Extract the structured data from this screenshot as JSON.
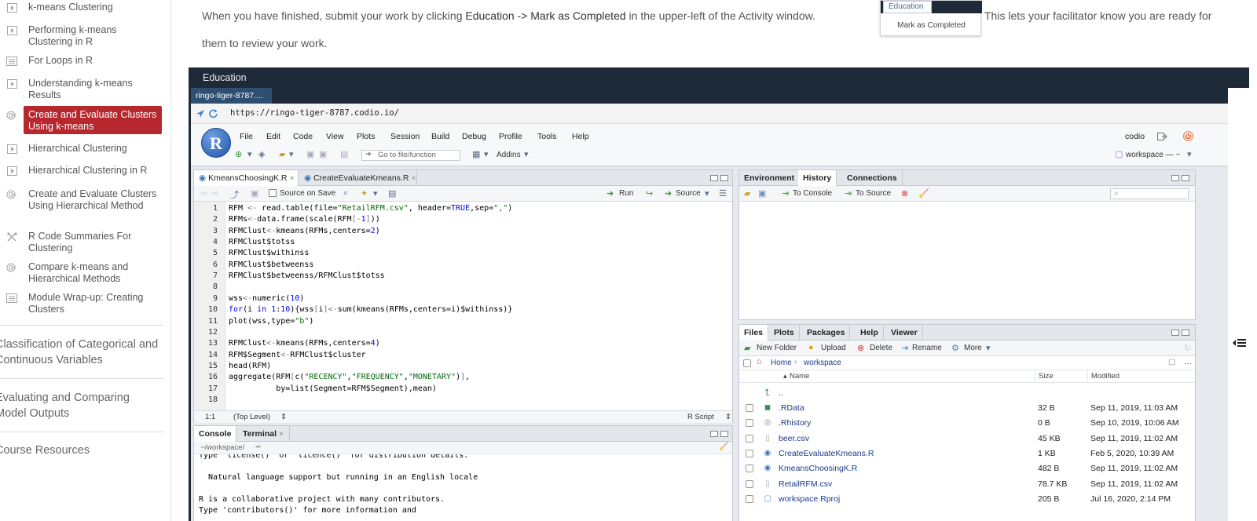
{
  "sidebar": {
    "items": [
      {
        "label": "k-means Clustering",
        "icon": "video-icon"
      },
      {
        "label": "Performing k-means Clustering in R",
        "icon": "video-icon"
      },
      {
        "label": "For Loops in R",
        "icon": "document-icon"
      },
      {
        "label": "Understanding k-means Results",
        "icon": "video-icon"
      },
      {
        "label": "Create and Evaluate Clusters Using k-means",
        "icon": "target-icon",
        "active": true
      },
      {
        "label": "Hierarchical Clustering",
        "icon": "video-icon"
      },
      {
        "label": "Hierarchical Clustering in R",
        "icon": "video-icon"
      },
      {
        "label": "Create and Evaluate Clusters Using Hierarchical Method",
        "icon": "target-icon"
      },
      {
        "label": "R Code Summaries For Clustering",
        "icon": "tools-icon"
      },
      {
        "label": "Compare k-means and Hierarchical Methods",
        "icon": "target-icon"
      },
      {
        "label": "Module Wrap-up: Creating Clusters",
        "icon": "document-icon"
      }
    ],
    "sections": [
      "Classification of Categorical and Continuous Variables",
      "Evaluating and Comparing Model Outputs",
      "Course Resources"
    ]
  },
  "instructions": {
    "line1_a": "When you have finished, submit your work by clicking ",
    "line1_b": "Education -> Mark as Completed",
    "line1_c": " in the upper-left of the Activity window.",
    "line1_d": "This lets your facilitator know you are ready for",
    "line2": "them to review your work."
  },
  "popup": {
    "menu": "Education",
    "item": "Mark as Completed"
  },
  "activity": {
    "title": "Education",
    "tab": "ringo-tiger-8787....",
    "url": "https://ringo-tiger-8787.codio.io/"
  },
  "rstudio": {
    "logo": "R",
    "menu": [
      "File",
      "Edit",
      "Code",
      "View",
      "Plots",
      "Session",
      "Build",
      "Debug",
      "Profile",
      "Tools",
      "Help"
    ],
    "user": "codio",
    "goto_placeholder": "Go to file/function",
    "addins": "Addins",
    "project": "workspace — ~",
    "editor": {
      "tabs": [
        "KmeansChoosingK.R",
        "CreateEvaluateKmeans.R"
      ],
      "source_on_save": "Source on Save",
      "run": "Run",
      "source": "Source",
      "lines": [
        "RFM <- read.table(file=\"RetailRFM.csv\", header=TRUE,sep=\",\")",
        "RFMs<-data.frame(scale(RFM[-1]))",
        "RFMClust<-kmeans(RFMs,centers=2)",
        "RFMClust$totss",
        "RFMClust$withinss",
        "RFMClust$betweenss",
        "RFMClust$betweenss/RFMClust$totss",
        "",
        "wss<-numeric(10)",
        "for(i in 1:10){wss[i]<-sum(kmeans(RFMs,centers=i)$withinss)}",
        "plot(wss,type=\"b\")",
        "",
        "RFMClust<-kmeans(RFMs,centers=4)",
        "RFM$Segment<-RFMClust$cluster",
        "head(RFM)",
        "aggregate(RFM[c(\"RECENCY\",\"FREQUENCY\",\"MONETARY\")],",
        "          by=list(Segment=RFM$Segment),mean)",
        ""
      ],
      "position": "1:1",
      "scope": "(Top Level)",
      "filetype": "R Script"
    },
    "console": {
      "tabs": [
        "Console",
        "Terminal"
      ],
      "path": "~/workspace/",
      "lines": [
        "Type 'license()' or 'licence()' for distribution details.",
        "",
        "  Natural language support but running in an English locale",
        "",
        "R is a collaborative project with many contributors.",
        "Type 'contributors()' for more information and"
      ]
    },
    "env": {
      "tabs": [
        "Environment",
        "History",
        "Connections"
      ],
      "to_console": "To Console",
      "to_source": "To Source"
    },
    "files": {
      "tabs": [
        "Files",
        "Plots",
        "Packages",
        "Help",
        "Viewer"
      ],
      "new_folder": "New Folder",
      "upload": "Upload",
      "delete": "Delete",
      "rename": "Rename",
      "more": "More",
      "breadcrumb_home": "Home",
      "breadcrumb_current": "workspace",
      "headers": {
        "name": "Name",
        "size": "Size",
        "modified": "Modified"
      },
      "parent": "..",
      "rows": [
        {
          "name": ".RData",
          "size": "32 B",
          "modified": "Sep 11, 2019, 11:03 AM",
          "icon": "rdata-icon"
        },
        {
          "name": ".Rhistory",
          "size": "0 B",
          "modified": "Sep 10, 2019, 10:06 AM",
          "icon": "rhistory-icon"
        },
        {
          "name": "beer.csv",
          "size": "45 KB",
          "modified": "Sep 11, 2019, 11:02 AM",
          "icon": "csv-file-icon"
        },
        {
          "name": "CreateEvaluateKmeans.R",
          "size": "1 KB",
          "modified": "Feb 5, 2020, 10:39 AM",
          "icon": "r-script-icon"
        },
        {
          "name": "KmeansChoosingK.R",
          "size": "482 B",
          "modified": "Sep 11, 2019, 11:02 AM",
          "icon": "r-script-icon"
        },
        {
          "name": "RetailRFM.csv",
          "size": "78.7 KB",
          "modified": "Sep 11, 2019, 11:02 AM",
          "icon": "csv-file-icon"
        },
        {
          "name": "workspace.Rproj",
          "size": "205 B",
          "modified": "Jul 16, 2020, 2:14 PM",
          "icon": "rproj-icon"
        }
      ]
    }
  }
}
